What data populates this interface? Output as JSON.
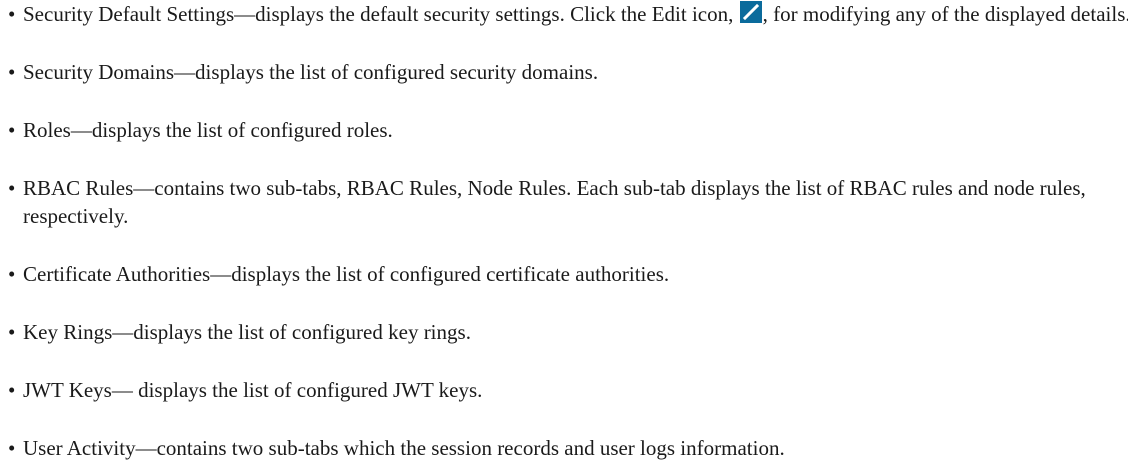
{
  "bullet": "•",
  "items": [
    {
      "before_icon": "Security Default Settings—displays the default security settings. Click the Edit icon, ",
      "icon": "edit-icon",
      "after_icon": ", for modifying any of the displayed details."
    },
    {
      "text": "Security Domains—displays the list of configured security domains."
    },
    {
      "text": "Roles—displays the list of configured roles."
    },
    {
      "text": "RBAC Rules—contains two sub-tabs, RBAC Rules, Node Rules. Each sub-tab displays the list of RBAC rules and node rules, respectively."
    },
    {
      "text": "Certificate Authorities—displays the list of configured certificate authorities."
    },
    {
      "text": "Key Rings—displays the list of configured key rings."
    },
    {
      "text": "JWT Keys— displays the list of configured JWT keys."
    },
    {
      "text": "User Activity—contains two sub-tabs which the session records and user logs information."
    }
  ],
  "colors": {
    "edit_icon_bg": "#0b6b9c",
    "text": "#1a1a1a"
  }
}
